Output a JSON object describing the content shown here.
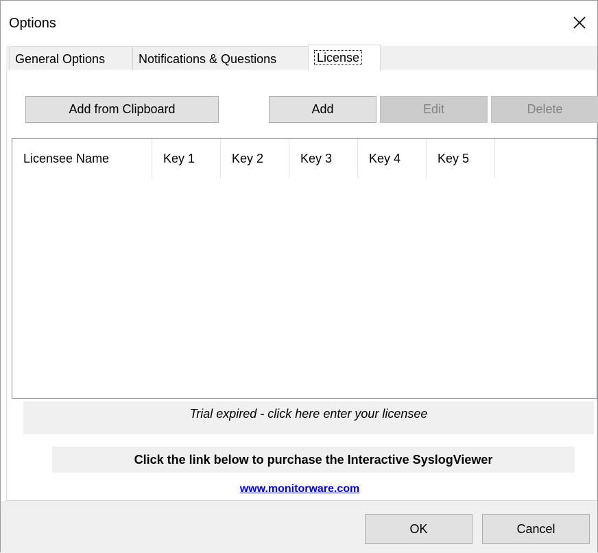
{
  "window": {
    "title": "Options"
  },
  "tabs": [
    {
      "label": "General Options"
    },
    {
      "label": "Notifications & Questions"
    },
    {
      "label": "License",
      "active": true
    }
  ],
  "toolbar": {
    "add_from_clipboard": "Add from Clipboard",
    "add": "Add",
    "edit": "Edit",
    "delete": "Delete"
  },
  "license_table": {
    "columns": [
      "Licensee Name",
      "Key 1",
      "Key 2",
      "Key 3",
      "Key 4",
      "Key 5"
    ],
    "rows": []
  },
  "trial_message": "Trial expired - click here enter your licensee",
  "purchase_text": "Click the link below to purchase the Interactive SyslogViewer",
  "purchase_link": "www.monitorware.com",
  "footer": {
    "ok": "OK",
    "cancel": "Cancel"
  },
  "colors": {
    "button_face": "#e1e1e1",
    "button_disabled": "#cccccc",
    "panel_gray": "#f0f0f0",
    "link": "#0000ee"
  },
  "icons": {
    "close": "close-icon"
  }
}
